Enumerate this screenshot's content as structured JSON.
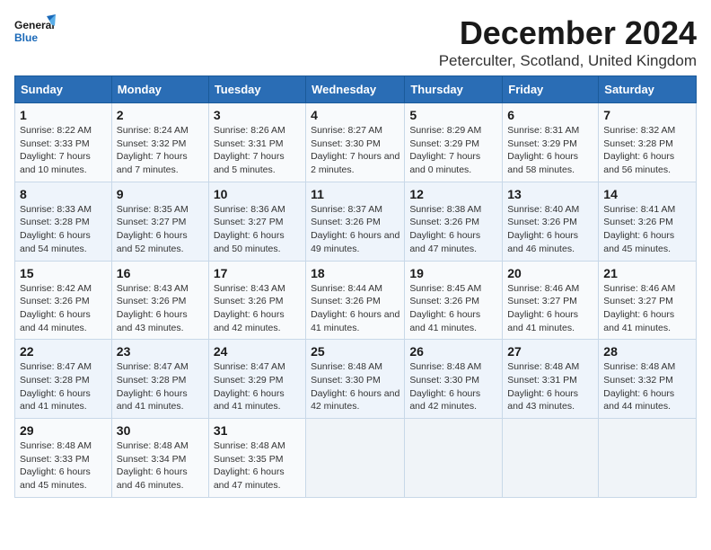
{
  "logo": {
    "line1": "General",
    "line2": "Blue"
  },
  "title": "December 2024",
  "location": "Peterculter, Scotland, United Kingdom",
  "weekdays": [
    "Sunday",
    "Monday",
    "Tuesday",
    "Wednesday",
    "Thursday",
    "Friday",
    "Saturday"
  ],
  "weeks": [
    [
      {
        "day": "1",
        "sunrise": "8:22 AM",
        "sunset": "3:33 PM",
        "daylight": "7 hours and 10 minutes."
      },
      {
        "day": "2",
        "sunrise": "8:24 AM",
        "sunset": "3:32 PM",
        "daylight": "7 hours and 7 minutes."
      },
      {
        "day": "3",
        "sunrise": "8:26 AM",
        "sunset": "3:31 PM",
        "daylight": "7 hours and 5 minutes."
      },
      {
        "day": "4",
        "sunrise": "8:27 AM",
        "sunset": "3:30 PM",
        "daylight": "7 hours and 2 minutes."
      },
      {
        "day": "5",
        "sunrise": "8:29 AM",
        "sunset": "3:29 PM",
        "daylight": "7 hours and 0 minutes."
      },
      {
        "day": "6",
        "sunrise": "8:31 AM",
        "sunset": "3:29 PM",
        "daylight": "6 hours and 58 minutes."
      },
      {
        "day": "7",
        "sunrise": "8:32 AM",
        "sunset": "3:28 PM",
        "daylight": "6 hours and 56 minutes."
      }
    ],
    [
      {
        "day": "8",
        "sunrise": "8:33 AM",
        "sunset": "3:28 PM",
        "daylight": "6 hours and 54 minutes."
      },
      {
        "day": "9",
        "sunrise": "8:35 AM",
        "sunset": "3:27 PM",
        "daylight": "6 hours and 52 minutes."
      },
      {
        "day": "10",
        "sunrise": "8:36 AM",
        "sunset": "3:27 PM",
        "daylight": "6 hours and 50 minutes."
      },
      {
        "day": "11",
        "sunrise": "8:37 AM",
        "sunset": "3:26 PM",
        "daylight": "6 hours and 49 minutes."
      },
      {
        "day": "12",
        "sunrise": "8:38 AM",
        "sunset": "3:26 PM",
        "daylight": "6 hours and 47 minutes."
      },
      {
        "day": "13",
        "sunrise": "8:40 AM",
        "sunset": "3:26 PM",
        "daylight": "6 hours and 46 minutes."
      },
      {
        "day": "14",
        "sunrise": "8:41 AM",
        "sunset": "3:26 PM",
        "daylight": "6 hours and 45 minutes."
      }
    ],
    [
      {
        "day": "15",
        "sunrise": "8:42 AM",
        "sunset": "3:26 PM",
        "daylight": "6 hours and 44 minutes."
      },
      {
        "day": "16",
        "sunrise": "8:43 AM",
        "sunset": "3:26 PM",
        "daylight": "6 hours and 43 minutes."
      },
      {
        "day": "17",
        "sunrise": "8:43 AM",
        "sunset": "3:26 PM",
        "daylight": "6 hours and 42 minutes."
      },
      {
        "day": "18",
        "sunrise": "8:44 AM",
        "sunset": "3:26 PM",
        "daylight": "6 hours and 41 minutes."
      },
      {
        "day": "19",
        "sunrise": "8:45 AM",
        "sunset": "3:26 PM",
        "daylight": "6 hours and 41 minutes."
      },
      {
        "day": "20",
        "sunrise": "8:46 AM",
        "sunset": "3:27 PM",
        "daylight": "6 hours and 41 minutes."
      },
      {
        "day": "21",
        "sunrise": "8:46 AM",
        "sunset": "3:27 PM",
        "daylight": "6 hours and 41 minutes."
      }
    ],
    [
      {
        "day": "22",
        "sunrise": "8:47 AM",
        "sunset": "3:28 PM",
        "daylight": "6 hours and 41 minutes."
      },
      {
        "day": "23",
        "sunrise": "8:47 AM",
        "sunset": "3:28 PM",
        "daylight": "6 hours and 41 minutes."
      },
      {
        "day": "24",
        "sunrise": "8:47 AM",
        "sunset": "3:29 PM",
        "daylight": "6 hours and 41 minutes."
      },
      {
        "day": "25",
        "sunrise": "8:48 AM",
        "sunset": "3:30 PM",
        "daylight": "6 hours and 42 minutes."
      },
      {
        "day": "26",
        "sunrise": "8:48 AM",
        "sunset": "3:30 PM",
        "daylight": "6 hours and 42 minutes."
      },
      {
        "day": "27",
        "sunrise": "8:48 AM",
        "sunset": "3:31 PM",
        "daylight": "6 hours and 43 minutes."
      },
      {
        "day": "28",
        "sunrise": "8:48 AM",
        "sunset": "3:32 PM",
        "daylight": "6 hours and 44 minutes."
      }
    ],
    [
      {
        "day": "29",
        "sunrise": "8:48 AM",
        "sunset": "3:33 PM",
        "daylight": "6 hours and 45 minutes."
      },
      {
        "day": "30",
        "sunrise": "8:48 AM",
        "sunset": "3:34 PM",
        "daylight": "6 hours and 46 minutes."
      },
      {
        "day": "31",
        "sunrise": "8:48 AM",
        "sunset": "3:35 PM",
        "daylight": "6 hours and 47 minutes."
      },
      null,
      null,
      null,
      null
    ]
  ],
  "labels": {
    "sunrise": "Sunrise:",
    "sunset": "Sunset:",
    "daylight": "Daylight:"
  }
}
